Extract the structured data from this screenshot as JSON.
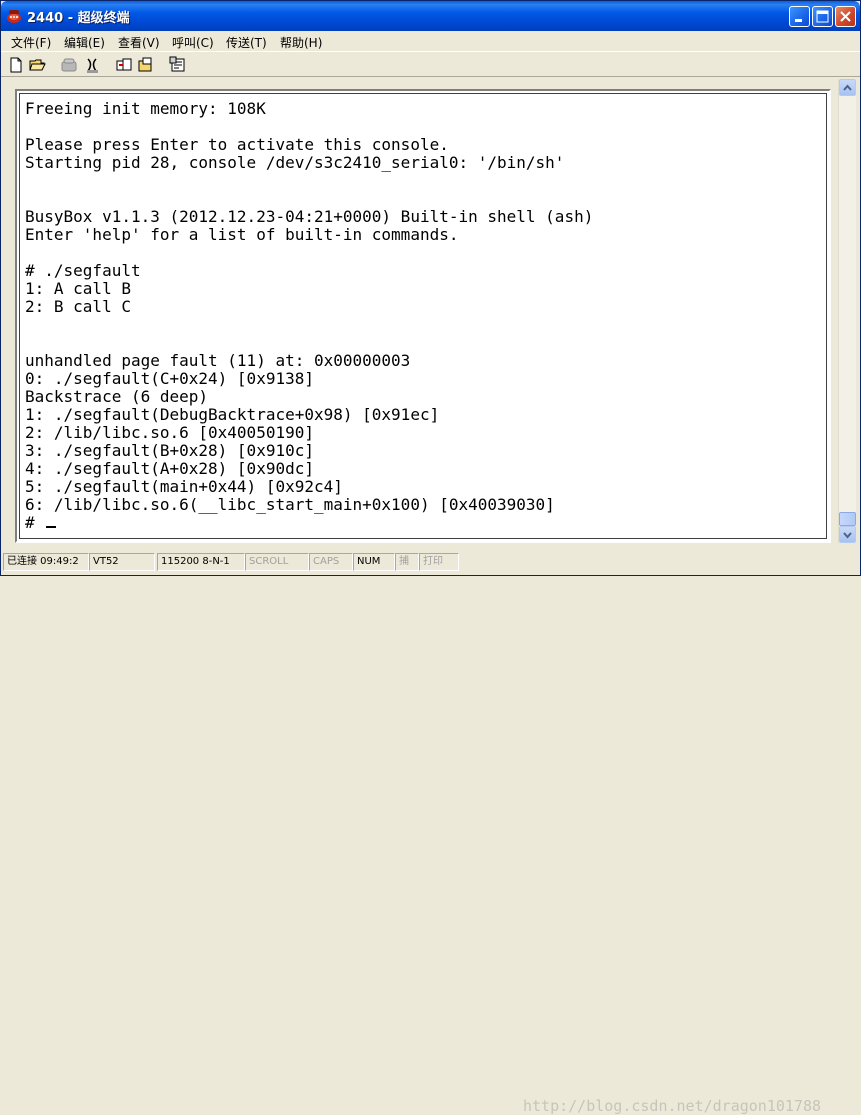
{
  "window": {
    "title": "2440 - 超级终端"
  },
  "menu": [
    "文件(F)",
    "编辑(E)",
    "查看(V)",
    "呼叫(C)",
    "传送(T)",
    "帮助(H)"
  ],
  "toolbar": {
    "icons": [
      "new-document-icon",
      "open-folder-icon",
      "phone-icon",
      "disconnect-icon",
      "send-icon",
      "receive-icon",
      "properties-icon"
    ]
  },
  "terminal": {
    "lines": [
      "Freeing init memory: 108K",
      "",
      "Please press Enter to activate this console.",
      "Starting pid 28, console /dev/s3c2410_serial0: '/bin/sh'",
      "",
      "",
      "BusyBox v1.1.3 (2012.12.23-04:21+0000) Built-in shell (ash)",
      "Enter 'help' for a list of built-in commands.",
      "",
      "# ./segfault",
      "1: A call B",
      "2: B call C",
      "",
      "",
      "unhandled page fault (11) at: 0x00000003",
      "0: ./segfault(C+0x24) [0x9138]",
      "Backstrace (6 deep)",
      "1: ./segfault(DebugBacktrace+0x98) [0x91ec]",
      "2: /lib/libc.so.6 [0x40050190]",
      "3: ./segfault(B+0x28) [0x910c]",
      "4: ./segfault(A+0x28) [0x90dc]",
      "5: ./segfault(main+0x44) [0x92c4]",
      "6: /lib/libc.so.6(__libc_start_main+0x100) [0x40039030]",
      "# "
    ]
  },
  "status": {
    "connected": "已连接 09:49:2",
    "emulation": "VT52",
    "port": "115200 8-N-1",
    "scroll": "SCROLL",
    "caps": "CAPS",
    "num": "NUM",
    "capture": "捕",
    "print": "打印"
  },
  "watermark": "http://blog.csdn.net/dragon101788"
}
